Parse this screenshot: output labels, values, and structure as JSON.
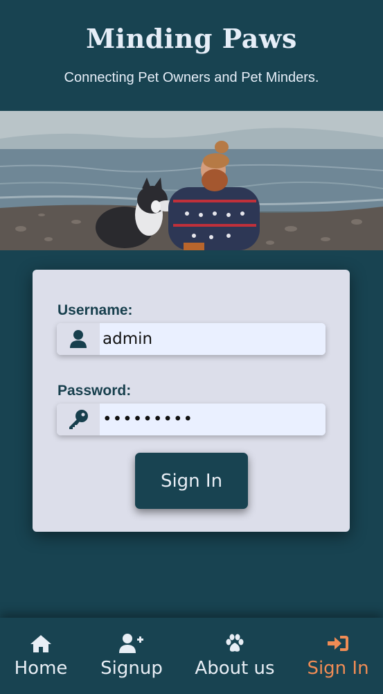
{
  "header": {
    "title": "Minding Paws",
    "tagline": "Connecting Pet Owners and Pet Minders."
  },
  "hero": {
    "image": "man-with-husky-on-beach"
  },
  "login_form": {
    "username_label": "Username:",
    "username_value": "admin",
    "username_icon": "user-icon",
    "password_label": "Password:",
    "password_value": "•••••••••",
    "password_icon": "key-icon",
    "submit_label": "Sign In"
  },
  "bottom_nav": {
    "items": [
      {
        "label": "Home",
        "icon": "home-icon",
        "active": false
      },
      {
        "label": "Signup",
        "icon": "user-plus-icon",
        "active": false
      },
      {
        "label": "About us",
        "icon": "paw-icon",
        "active": false
      },
      {
        "label": "Sign In",
        "icon": "sign-in-icon",
        "active": true
      }
    ]
  },
  "colors": {
    "background": "#184351",
    "card": "#dcdeea",
    "input": "#eaf0ff",
    "accent": "#f08c55",
    "text_light": "#e8eef5"
  }
}
